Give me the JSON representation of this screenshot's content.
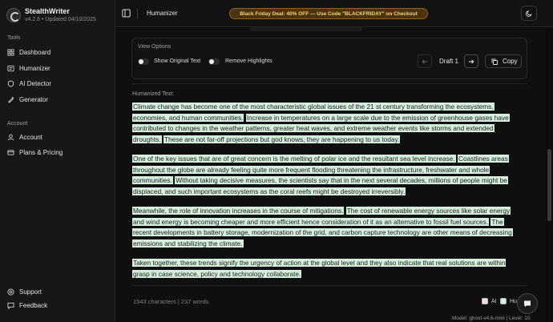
{
  "brand": {
    "name": "StealthWriter",
    "version": "v4.2.6 • Updated 04/10/2025"
  },
  "sidebar": {
    "tools_label": "Tools",
    "tools": [
      {
        "label": "Dashboard",
        "icon": "dashboard-icon"
      },
      {
        "label": "Humanizer",
        "icon": "humanizer-icon"
      },
      {
        "label": "AI Detector",
        "icon": "detector-icon"
      },
      {
        "label": "Generator",
        "icon": "generator-icon"
      }
    ],
    "account_label": "Account",
    "account": [
      {
        "label": "Account",
        "icon": "user-icon"
      },
      {
        "label": "Plans & Pricing",
        "icon": "pricing-icon"
      }
    ],
    "bottom": [
      {
        "label": "Support",
        "icon": "support-icon"
      },
      {
        "label": "Feedback",
        "icon": "feedback-icon"
      }
    ]
  },
  "topbar": {
    "title": "Humanizer",
    "promo": "Black Friday Deal: 40% OFF — Use Code \"BLACKFRIDAY\" on Checkout"
  },
  "view_options": {
    "title": "View Options",
    "show_original": "Show Original Text",
    "remove_highlights": "Remove Highlights",
    "draft": "Draft 1",
    "copy": "Copy"
  },
  "output": {
    "label": "Humanized Text:",
    "paragraphs": [
      [
        "Climate change has become one of the most characteristic global issues of the 21 st century transforming the ecosystems, economies, and human communities.",
        "Increase in temperatures on a large scale due to the emission of greenhouse gases have contributed to changes in the weather patterns, greater heat waves, and extreme weather events like storms and extended droughts.",
        "These are not far-off projections but god knows, they are happening to us today."
      ],
      [
        "One of the key issues that are of great concern is the melting of polar ice and the resultant sea level increase.",
        "Coastlines areas throughout the globe are already feeling quite more frequent flooding threatening the infrastructure, freshwater and whole communities.",
        "Without taking decisive measures, the scientists say that in the next several decades, millions of people might be displaced, and such important ecosystems as the coral reefs might be destroyed irreversibly."
      ],
      [
        "Meanwhile, the role of innovation increases in the course of mitigations.",
        "The cost of renewable energy sources like solar energy and wind energy is becoming cheaper and more efficient hence consideration of it as an alternative to fossil fuel sources.",
        "The recent developments in battery storage, modernization of the grid, and carbon capture technology are other means of decreasing emissions and stabilizing the climate."
      ],
      [
        "Taken together, these trends signify the urgency of action at the global level and they also indicate that real solutions are within grasp in case science, policy and technology collaborate."
      ]
    ]
  },
  "footer": {
    "stats": "1543 characters | 237 words",
    "legend_ai": "AI",
    "legend_human": "Hu",
    "model": "Model: ghost-v4.6-mini | Level: 10"
  },
  "colors": {
    "highlight": "#d6eedd",
    "promo_bg": "#4a3410",
    "promo_text": "#f4d37d"
  }
}
